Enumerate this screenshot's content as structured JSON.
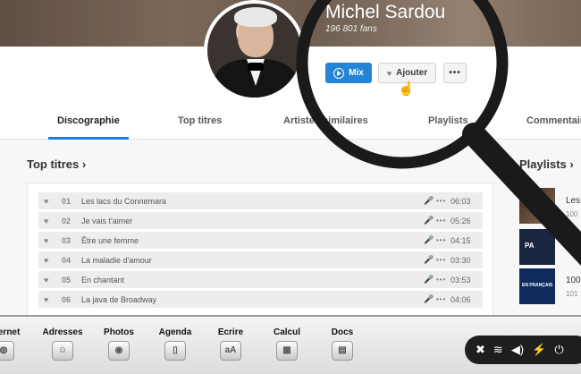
{
  "artist": {
    "name": "Michel Sardou",
    "fans": "196 801 fans"
  },
  "actions": {
    "mix_label": "Mix",
    "add_label": "Ajouter",
    "more_label": "•••"
  },
  "tabs": [
    {
      "label": "Discographie",
      "active": true
    },
    {
      "label": "Top titres",
      "active": false
    },
    {
      "label": "Artistes similaires",
      "active": false
    },
    {
      "label": "Playlists",
      "active": false
    },
    {
      "label": "Commentaires",
      "active": false
    }
  ],
  "top_titles": {
    "heading": "Top titres ›",
    "tracks": [
      {
        "num": "01",
        "title": "Les lacs du Connemara",
        "duration": "06:03"
      },
      {
        "num": "02",
        "title": "Je vais t'aimer",
        "duration": "05:26"
      },
      {
        "num": "03",
        "title": "Être une femme",
        "duration": "04:15"
      },
      {
        "num": "04",
        "title": "La maladie d'amour",
        "duration": "03:30"
      },
      {
        "num": "05",
        "title": "En chantant",
        "duration": "03:53"
      },
      {
        "num": "06",
        "title": "La java de Broadway",
        "duration": "04:06"
      }
    ]
  },
  "playlists": {
    "heading": "Playlists ›",
    "items": [
      {
        "title": "Les",
        "sub": "100"
      },
      {
        "title": "",
        "sub": "",
        "thumb_text": "PA"
      },
      {
        "title": "100",
        "sub": "101",
        "thumb_text": "EN FRANÇAIS"
      }
    ]
  },
  "taskbar": [
    {
      "label": "Internet",
      "icon": "globe-icon"
    },
    {
      "label": "Adresses",
      "icon": "contacts-icon"
    },
    {
      "label": "Photos",
      "icon": "camera-icon"
    },
    {
      "label": "Agenda",
      "icon": "book-icon"
    },
    {
      "label": "Ecrire",
      "icon": "text-icon",
      "glyph": "aA"
    },
    {
      "label": "Calcul",
      "icon": "calculator-icon"
    },
    {
      "label": "Docs",
      "icon": "document-icon"
    }
  ],
  "tray": [
    "tools-icon",
    "wifi-icon",
    "volume-icon",
    "battery-charging-icon",
    "power-icon"
  ],
  "colors": {
    "accent": "#1c7fd6",
    "taskbar": "#e6e6e6",
    "tray": "#1e1e1e"
  }
}
